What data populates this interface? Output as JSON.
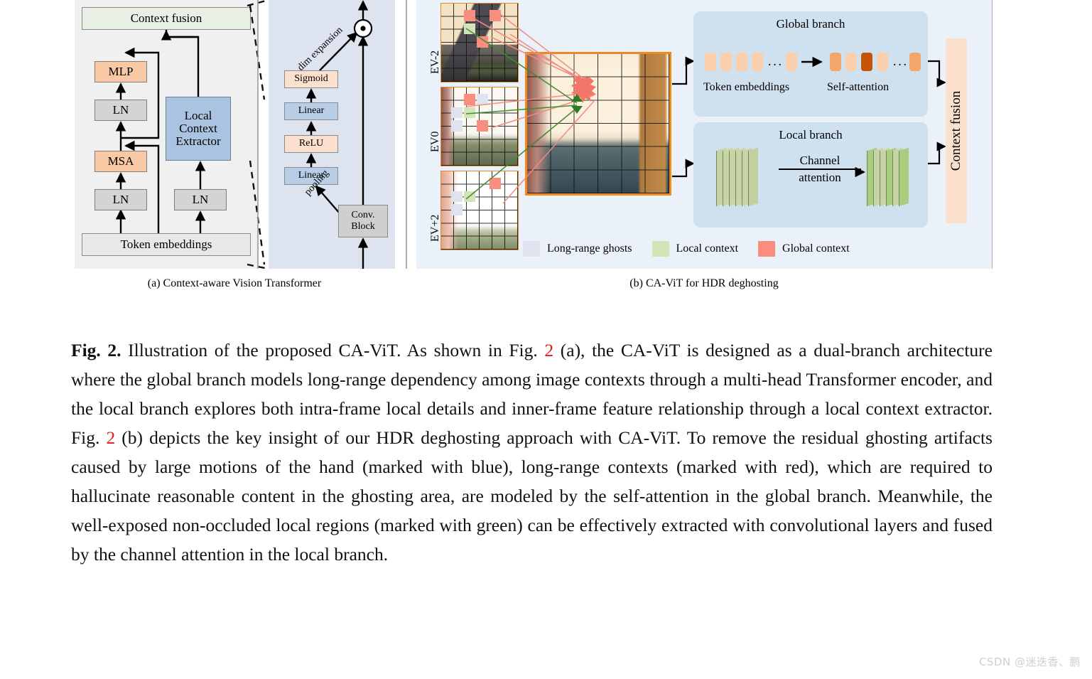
{
  "figure": {
    "panel_a": {
      "caption": "(a) Context-aware Vision Transformer",
      "blocks": {
        "context_fusion": "Context fusion",
        "mlp": "MLP",
        "ln_top": "LN",
        "msa": "MSA",
        "ln_bottom": "LN",
        "ln_right": "LN",
        "local_context_extractor_line1": "Local",
        "local_context_extractor_line2": "Context",
        "local_context_extractor_line3": "Extractor",
        "token_embeddings": "Token embeddings"
      },
      "colors": {
        "panel_bg": "#f0f0f0",
        "context_fusion": "#e8efe4",
        "mlp": "#f8c9a4",
        "msa": "#f8c9a4",
        "ln": "#d4d4d4",
        "lce": "#a9c3e0",
        "token_embeddings": "#e8e8e8"
      }
    },
    "panel_b_detail": {
      "blocks": {
        "sigmoid": "Sigmoid",
        "linear_top": "Linear",
        "relu": "ReLU",
        "linear_bottom": "Linear",
        "conv_block_line1": "Conv.",
        "conv_block_line2": "Block"
      },
      "edge_labels": {
        "dim_expansion": "dim expansion",
        "pooling": "pooling"
      },
      "operator": "⊙",
      "colors": {
        "panel_bg": "#dde4f0",
        "sigmoid": "#fbe0cd",
        "relu": "#fbe0cd",
        "linear": "#b8cde6",
        "conv_block": "#cfcfcf"
      }
    },
    "panel_c": {
      "caption": "(b) CA-ViT for HDR deghosting",
      "exposure_labels": [
        "EV-2",
        "EV0",
        "EV+2"
      ],
      "global_branch": {
        "title": "Global branch",
        "left_label": "Token embeddings",
        "right_label": "Self-attention",
        "token_count_left": 5,
        "token_count_right": 5,
        "ellipsis": "···"
      },
      "local_branch": {
        "title": "Local branch",
        "arrow_label_line1": "Channel",
        "arrow_label_line2": "attention",
        "feature_planes": 6
      },
      "context_fusion_bar": "Context fusion",
      "legend": [
        {
          "label": "Long-range ghosts",
          "color": "#dfe3ef"
        },
        {
          "label": "Local context",
          "color": "#d3e5b6"
        },
        {
          "label": "Global context",
          "color": "#f98e7f"
        }
      ],
      "colors": {
        "panel_bg": "#eaf1f9",
        "branch_bg": "#cfe0ef",
        "fusion_bar": "#fbe0cd",
        "image_border": "#f18a1c",
        "token_light": "#f9cfae",
        "token_mid": "#f2a66a",
        "token_dark": "#c55408",
        "feature_plane": "#c3cf9f",
        "feature_plane_hi": "#a9cc7e"
      }
    }
  },
  "caption": {
    "lead": "Fig. 2.",
    "parts": [
      {
        "t": " Illustration of the proposed CA-ViT. As shown in Fig. ",
        "red": false
      },
      {
        "t": "2",
        "red": true
      },
      {
        "t": " (a), the CA-ViT is designed as a dual-branch architecture where the global branch models long-range dependency among image contexts through a multi-head Transformer encoder, and the local branch explores both intra-frame local details and inner-frame feature relationship through a local context extractor. Fig. ",
        "red": false
      },
      {
        "t": "2",
        "red": true
      },
      {
        "t": " (b) depicts the key insight of our HDR deghosting approach with CA-ViT. To remove the residual ghosting artifacts caused by large motions of the hand (marked with blue), long-range contexts (marked with red), which are required to hallucinate reasonable content in the ghosting area, are modeled by the self-attention in the global branch. Meanwhile, the well-exposed non-occluded local regions (marked with green) can be effectively extracted with convolutional layers and fused by the channel attention in the local branch.",
        "red": false
      }
    ]
  },
  "watermark": "CSDN @迷迭香、鹏"
}
